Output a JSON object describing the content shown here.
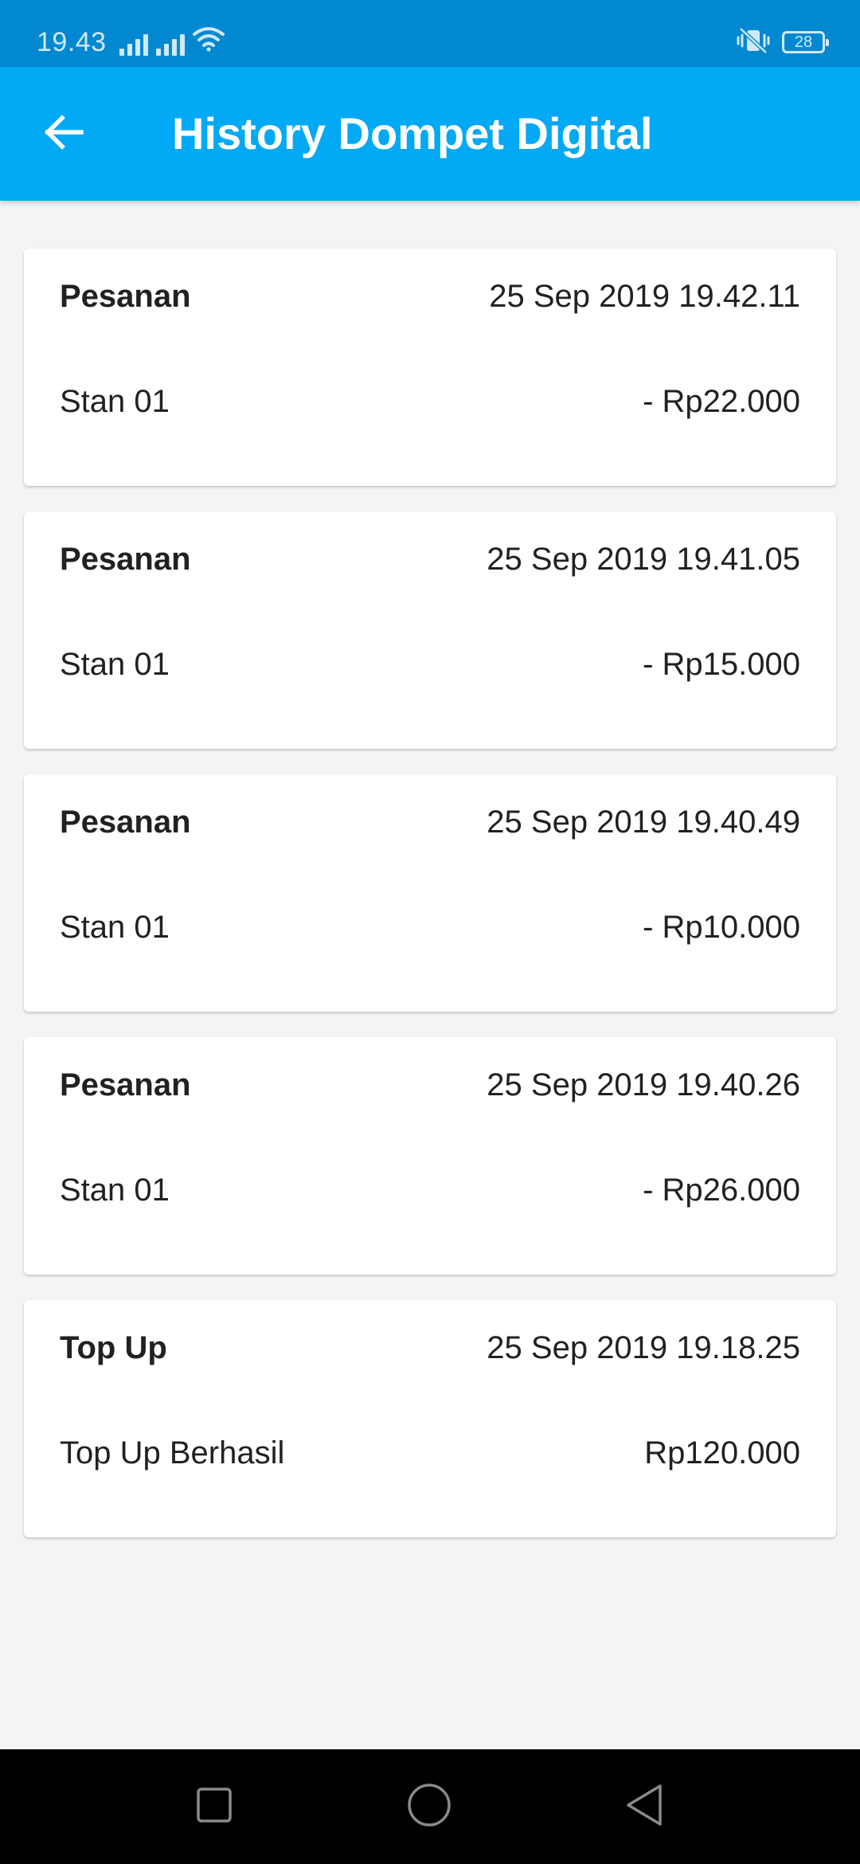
{
  "status_bar": {
    "time": "19.43",
    "battery": "28"
  },
  "app_bar": {
    "title": "History Dompet Digital"
  },
  "transactions": [
    {
      "type": "Pesanan",
      "datetime": "25 Sep 2019 19.42.11",
      "description": "Stan 01",
      "amount": "- Rp22.000"
    },
    {
      "type": "Pesanan",
      "datetime": "25 Sep 2019 19.41.05",
      "description": "Stan 01",
      "amount": "- Rp15.000"
    },
    {
      "type": "Pesanan",
      "datetime": "25 Sep 2019 19.40.49",
      "description": "Stan 01",
      "amount": "- Rp10.000"
    },
    {
      "type": "Pesanan",
      "datetime": "25 Sep 2019 19.40.26",
      "description": "Stan 01",
      "amount": "- Rp26.000"
    },
    {
      "type": "Top Up",
      "datetime": "25 Sep 2019 19.18.25",
      "description": "Top Up Berhasil",
      "amount": "Rp120.000"
    }
  ],
  "icons": {
    "back": "arrow-left-icon",
    "signal": "signal-icon",
    "wifi": "wifi-icon",
    "vibrate": "vibrate-icon",
    "nav_recents": "square-icon",
    "nav_home": "circle-icon",
    "nav_back": "triangle-icon"
  },
  "colors": {
    "status_bar": "#0288d1",
    "app_bar": "#03a9f4",
    "background": "#f4f4f4"
  }
}
